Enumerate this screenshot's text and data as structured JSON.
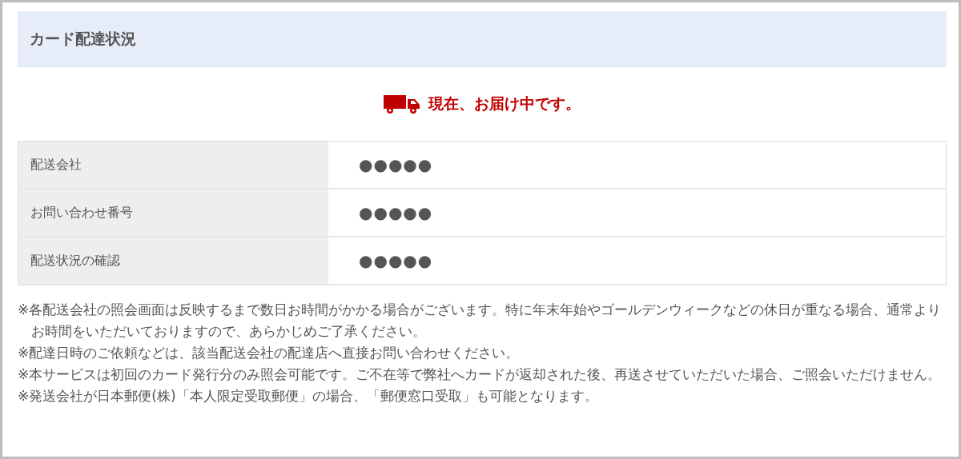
{
  "card_title": "カード配達状況",
  "status": {
    "text": "現在、お届け中です。"
  },
  "details": [
    {
      "label": "配送会社",
      "value": "●●●●●"
    },
    {
      "label": "お問い合わせ番号",
      "value": "●●●●●"
    },
    {
      "label": "配送状況の確認",
      "value": "●●●●●"
    }
  ],
  "notes": [
    "※各配送会社の照会画面は反映するまで数日お時間がかかる場合がございます。特に年末年始やゴールデンウィークなどの休日が重なる場合、通常よりお時間をいただいておりますので、あらかじめご了承ください。",
    "※配達日時のご依頼などは、該当配送会社の配達店へ直接お問い合わせください。",
    "※本サービスは初回のカード発行分のみ照会可能です。ご不在等で弊社へカードが返却された後、再送させていただいた場合、ご照会いただけません。",
    "※発送会社が日本郵便(株)「本人限定受取郵便」の場合、「郵便窓口受取」も可能となります。"
  ]
}
